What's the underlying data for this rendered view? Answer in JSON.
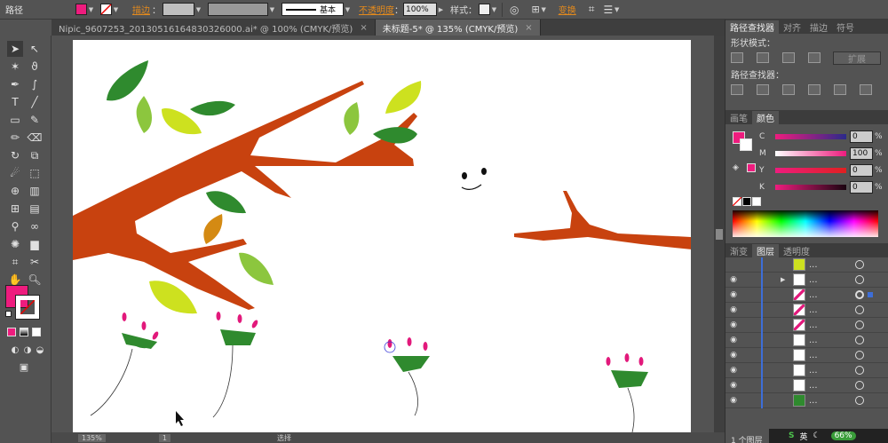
{
  "control_bar": {
    "label": "路径",
    "stroke_label": "描边",
    "stroke_profile": "基本",
    "opacity_label": "不透明度",
    "opacity_value": "100%",
    "style_label": "样式",
    "transform_label": "变换",
    "fill_color": "#ee1c7e"
  },
  "doc_tabs": [
    {
      "title": "Nipic_9607253_20130516164830326000.ai* @ 100% (CMYK/预览)",
      "close": "×"
    },
    {
      "title": "未标题-5* @ 135% (CMYK/预览)",
      "close": "×"
    }
  ],
  "pathfinder_panel": {
    "tabs": [
      "路径查找器",
      "对齐",
      "描边",
      "符号"
    ],
    "shape_modes_label": "形状模式：",
    "expand_button": "扩展",
    "pathfinders_label": "路径查找器："
  },
  "color_panel": {
    "tabs": [
      "画笔",
      "颜色"
    ],
    "channels": [
      {
        "letter": "C",
        "value": "0",
        "unit": "%"
      },
      {
        "letter": "M",
        "value": "100",
        "unit": "%"
      },
      {
        "letter": "Y",
        "value": "0",
        "unit": "%"
      },
      {
        "letter": "K",
        "value": "0",
        "unit": "%"
      }
    ]
  },
  "layers_panel": {
    "tabs": [
      "渐变",
      "图层",
      "透明度"
    ],
    "row_label": "...",
    "layer_count": "1 个图层"
  },
  "status_bar": {
    "zoom": "135%",
    "page": "1",
    "tool": "选择"
  },
  "taskbar": {
    "ime": "英",
    "battery": "66%"
  },
  "colors": {
    "branch": "#c8420f",
    "leaf_dark": "#2f8a2e",
    "leaf_light": "#8cc63e",
    "leaf_yellow": "#cde11f",
    "leaf_orange": "#d48a13",
    "petal": "#e2197b"
  }
}
